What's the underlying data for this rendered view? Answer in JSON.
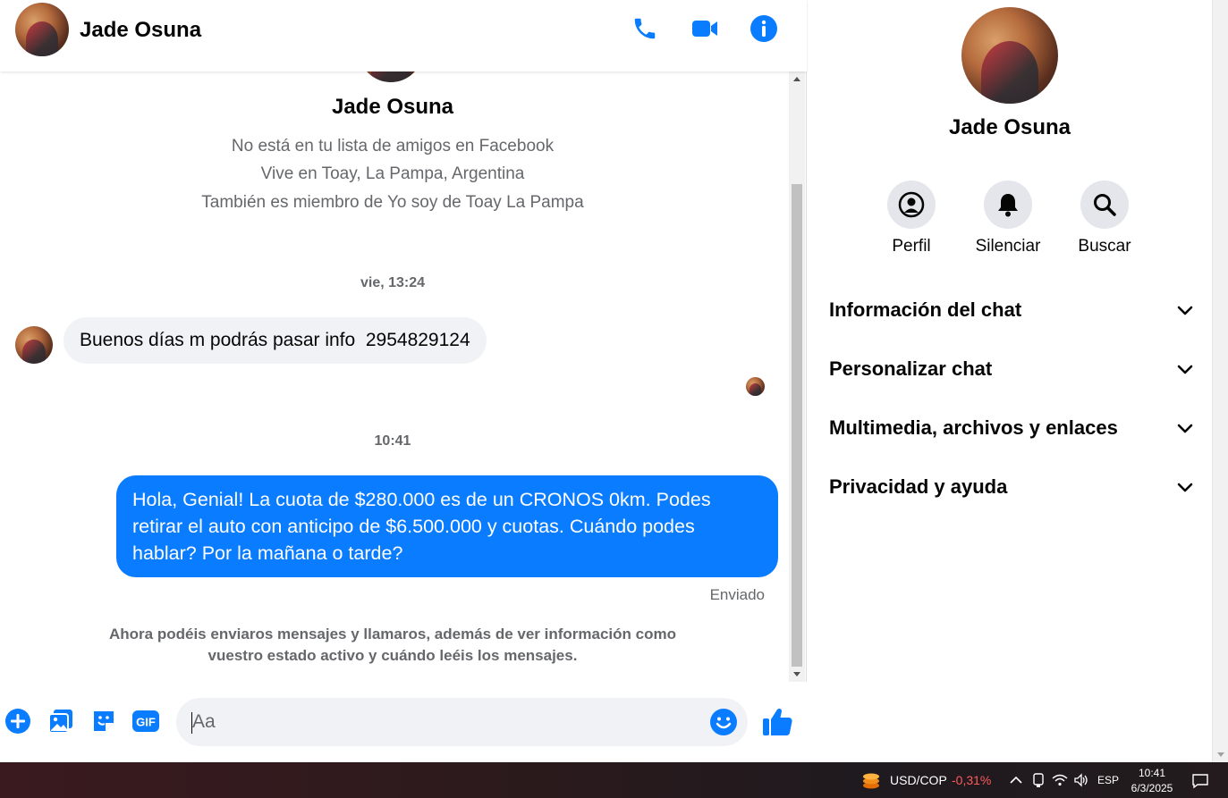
{
  "header": {
    "contact_name": "Jade Osuna",
    "icons": {
      "call": "phone-icon",
      "video": "video-camera-icon",
      "info": "info-icon"
    }
  },
  "profile": {
    "name": "Jade Osuna",
    "lines": [
      "No está en tu lista de amigos en Facebook",
      "Vive en Toay, La Pampa, Argentina",
      "También es miembro de Yo soy de Toay La Pampa"
    ]
  },
  "messages": {
    "timestamp_1": "vie, 13:24",
    "incoming_1": "Buenos días m podrás pasar info  2954829124",
    "timestamp_2": "10:41",
    "outgoing_1": "Hola, Genial! La cuota de $280.000 es de un CRONOS 0km. Podes retirar el auto con anticipo de $6.500.000 y cuotas. Cuándo podes hablar? Por la mañana o tarde?",
    "sent_status": "Enviado",
    "notice": "Ahora podéis enviaros mensajes y llamaros, además de ver información como vuestro estado activo y cuándo leéis los mensajes."
  },
  "composer": {
    "placeholder": "Aa",
    "gif_label": "GIF",
    "icons": [
      "plus-icon",
      "photo-icon",
      "sticker-icon",
      "gif-icon",
      "emoji-icon",
      "thumbs-up-icon"
    ]
  },
  "info_panel": {
    "name": "Jade Osuna",
    "actions": [
      {
        "label": "Perfil",
        "icon": "profile-icon"
      },
      {
        "label": "Silenciar",
        "icon": "bell-icon"
      },
      {
        "label": "Buscar",
        "icon": "search-icon"
      }
    ],
    "sections": [
      "Información del chat",
      "Personalizar chat",
      "Multimedia, archivos y enlaces",
      "Privacidad y ayuda"
    ]
  },
  "taskbar": {
    "ticker_pair": "USD/COP",
    "ticker_change": "-0,31%",
    "language": "ESP",
    "time": "10:41",
    "date": "6/3/2025"
  },
  "colors": {
    "accent": "#0a7cff",
    "outgoing_bubble": "#0a7cff",
    "incoming_bubble": "#f0f2f5",
    "secondary_text": "#65676b",
    "negative_change": "#ff5a5a"
  }
}
